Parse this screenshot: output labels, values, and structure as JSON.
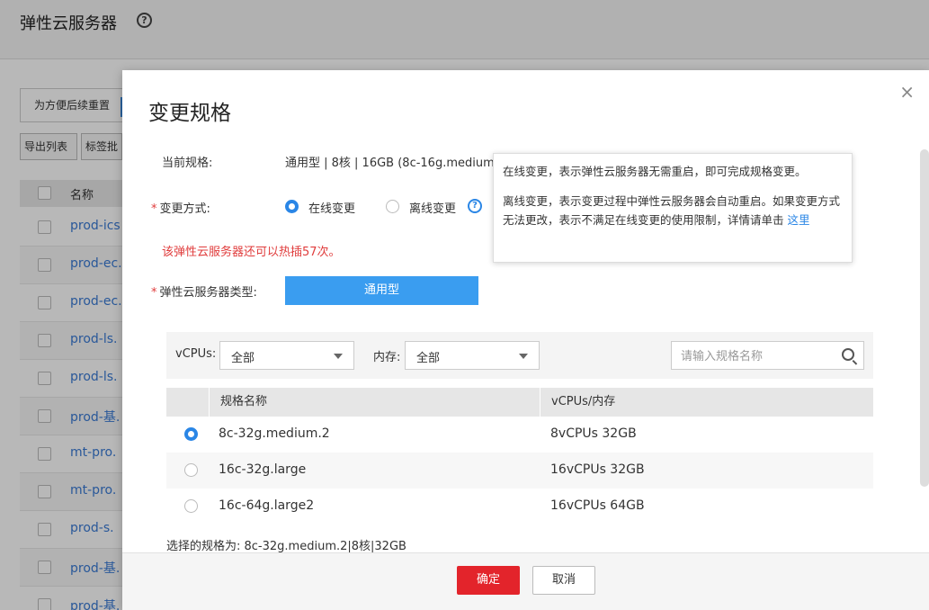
{
  "background": {
    "title": "弹性云服务器",
    "tip_button": "为方便后续重置",
    "export_button": "导出列表",
    "tag_button": "标签批",
    "table_header_name": "名称",
    "rows": [
      "prod-ics",
      "prod-ec.",
      "prod-ec.",
      "prod-ls.",
      "prod-ls.",
      "prod-基.",
      "mt-pro.",
      "mt-pro.",
      "prod-s.",
      "prod-基.",
      "prod-基."
    ]
  },
  "dialog": {
    "title": "变更规格",
    "close_label": "×",
    "current_spec_label": "当前规格:",
    "current_spec_value": "通用型 | 8核 | 16GB (8c-16g.medium",
    "change_mode_label": "变更方式:",
    "change_mode_options": [
      "在线变更",
      "离线变更"
    ],
    "change_mode_selected": "在线变更",
    "warning": "该弹性云服务器还可以热插57次。",
    "server_type_label": "弹性云服务器类型:",
    "server_type_button": "通用型",
    "filters": {
      "vcpus_label": "vCPUs:",
      "vcpus_value": "全部",
      "memory_label": "内存:",
      "memory_value": "全部",
      "search_placeholder": "请输入规格名称"
    },
    "table": {
      "headers": [
        "规格名称",
        "vCPUs/内存"
      ],
      "rows": [
        {
          "name": "8c-32g.medium.2",
          "spec": "8vCPUs 32GB",
          "selected": true
        },
        {
          "name": "16c-32g.large",
          "spec": "16vCPUs 32GB",
          "selected": false
        },
        {
          "name": "16c-64g.large2",
          "spec": "16vCPUs 64GB",
          "selected": false
        }
      ]
    },
    "selected_spec": "选择的规格为: 8c-32g.medium.2|8核|32GB",
    "ok_button": "确定",
    "cancel_button": "取消",
    "tooltip": {
      "line1": "在线变更，表示弹性云服务器无需重启，即可完成规格变更。",
      "line2": "离线变更，表示变更过程中弹性云服务器会自动重启。如果变更方式无法更改，表示不满足在线变更的使用限制，详情请单击",
      "link": "这里"
    }
  },
  "colors": {
    "accent_blue": "#2a86e6",
    "danger_red": "#e3242b",
    "type_button_blue": "#3a9df0"
  }
}
